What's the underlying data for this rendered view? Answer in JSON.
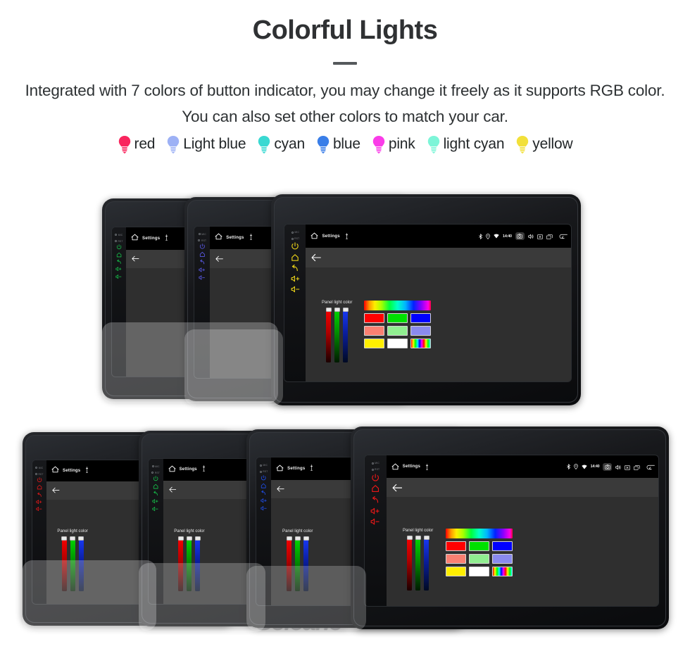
{
  "header": {
    "title": "Colorful Lights",
    "subtitle": "Integrated with 7 colors of button indicator, you may change it freely as it supports RGB color. You can also set other colors to match your car."
  },
  "legend": {
    "items": [
      {
        "label": "red",
        "color": "#f9265e",
        "icon": "bulb-icon"
      },
      {
        "label": "Light blue",
        "color": "#9db1f5",
        "icon": "bulb-icon"
      },
      {
        "label": "cyan",
        "color": "#3ad9d2",
        "icon": "bulb-icon"
      },
      {
        "label": "blue",
        "color": "#3a7ee8",
        "icon": "bulb-icon"
      },
      {
        "label": "pink",
        "color": "#fa3ce8",
        "icon": "bulb-icon"
      },
      {
        "label": "light cyan",
        "color": "#7df5d8",
        "icon": "bulb-icon"
      },
      {
        "label": "yellow",
        "color": "#f2e03a",
        "icon": "bulb-icon"
      }
    ]
  },
  "device_ui": {
    "status_title": "Settings",
    "clock": "14:40",
    "home_icon": "home-icon",
    "mic_icon": "microphone-icon",
    "bluetooth_icon": "bluetooth-icon",
    "location_icon": "location-icon",
    "wifi_icon": "wifi-icon",
    "camera_icon": "camera-icon",
    "volume_icon": "volume-icon",
    "close_icon": "close-box-icon",
    "recents_icon": "recents-icon",
    "back_nav_icon": "back-nav-icon",
    "action_back_icon": "arrow-left-icon",
    "panel_label": "Panel light color",
    "keys": {
      "mic_label": "MIC",
      "rst_label": "RST",
      "power_icon": "power-icon",
      "home_key_icon": "home-key-icon",
      "back_key_icon": "back-key-icon",
      "vol_up_icon": "volume-up-icon",
      "vol_down_icon": "volume-down-icon"
    },
    "sliders": [
      {
        "name": "red",
        "value": 92,
        "color": "#ff0000"
      },
      {
        "name": "green",
        "value": 92,
        "color": "#00dd00"
      },
      {
        "name": "blue",
        "value": 92,
        "color": "#1a3cff"
      }
    ],
    "swatches": [
      [
        "#ff0000",
        "#00e000",
        "#0000ff"
      ],
      [
        "#fa8072",
        "#90ee90",
        "#8a8aee"
      ],
      [
        "#ffef00",
        "#ffffff",
        "rainbow"
      ]
    ]
  },
  "devices": {
    "top_row": [
      {
        "key_color": "#16c44b"
      },
      {
        "key_color": "#5a5ae8"
      },
      {
        "key_color": "#e8d018"
      }
    ],
    "bottom_row": [
      {
        "key_color": "#e81818"
      },
      {
        "key_color": "#16c44b"
      },
      {
        "key_color": "#2050f0"
      },
      {
        "key_color": "#e81818"
      }
    ]
  },
  "watermark": {
    "text": "Seicane"
  }
}
